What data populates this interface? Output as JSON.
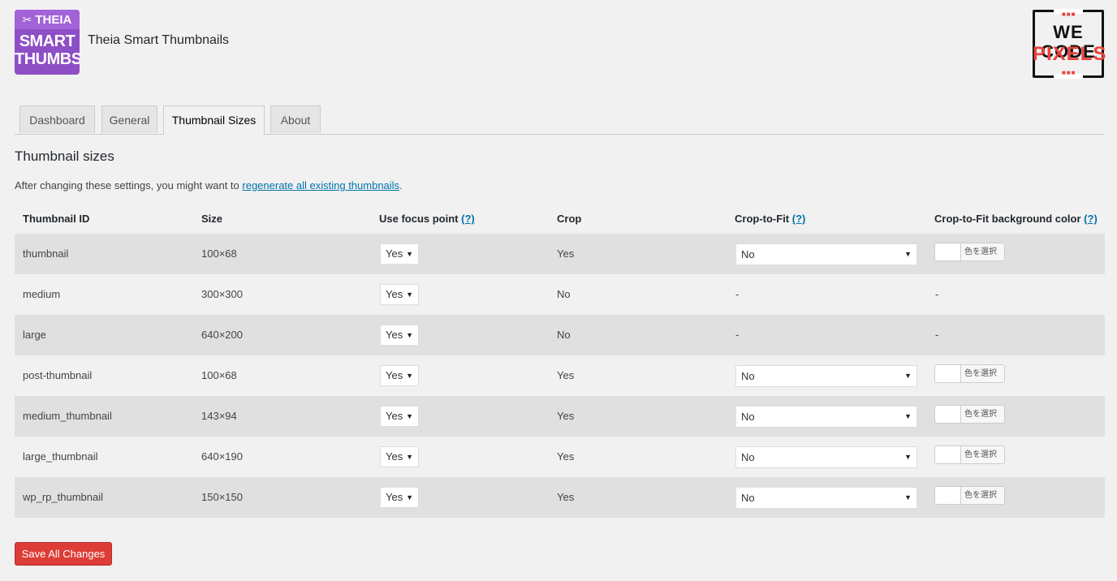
{
  "header": {
    "logo": {
      "line1": "THEIA",
      "line2": "SMART",
      "line3": "THUMBS"
    },
    "title": "Theia Smart Thumbnails",
    "brand": {
      "line1": "WE CODE",
      "line2": "PIXELS"
    }
  },
  "tabs": [
    {
      "label": "Dashboard",
      "active": false
    },
    {
      "label": "General",
      "active": false
    },
    {
      "label": "Thumbnail Sizes",
      "active": true
    },
    {
      "label": "About",
      "active": false
    }
  ],
  "section": {
    "title": "Thumbnail sizes",
    "intro_prefix": "After changing these settings, you might want to ",
    "intro_link": "regenerate all existing thumbnails",
    "intro_suffix": "."
  },
  "table": {
    "headers": {
      "id": "Thumbnail ID",
      "size": "Size",
      "focus": "Use focus point",
      "crop": "Crop",
      "fit": "Crop-to-Fit",
      "bg": "Crop-to-Fit background color",
      "help": "(?)"
    },
    "rows": [
      {
        "id": "thumbnail",
        "size": "100×68",
        "focus": "Yes",
        "crop": "Yes",
        "fit": "No",
        "bg": "色を選択"
      },
      {
        "id": "medium",
        "size": "300×300",
        "focus": "Yes",
        "crop": "No",
        "fit": "-",
        "bg": "-"
      },
      {
        "id": "large",
        "size": "640×200",
        "focus": "Yes",
        "crop": "No",
        "fit": "-",
        "bg": "-"
      },
      {
        "id": "post-thumbnail",
        "size": "100×68",
        "focus": "Yes",
        "crop": "Yes",
        "fit": "No",
        "bg": "色を選択"
      },
      {
        "id": "medium_thumbnail",
        "size": "143×94",
        "focus": "Yes",
        "crop": "Yes",
        "fit": "No",
        "bg": "色を選択"
      },
      {
        "id": "large_thumbnail",
        "size": "640×190",
        "focus": "Yes",
        "crop": "Yes",
        "fit": "No",
        "bg": "色を選択"
      },
      {
        "id": "wp_rp_thumbnail",
        "size": "150×150",
        "focus": "Yes",
        "crop": "Yes",
        "fit": "No",
        "bg": "色を選択"
      }
    ]
  },
  "save_button": "Save All Changes",
  "colors": {
    "accent": "#8e4ec6",
    "link": "#0073aa",
    "danger": "#dd3d36",
    "brand_red": "#e8433b"
  }
}
